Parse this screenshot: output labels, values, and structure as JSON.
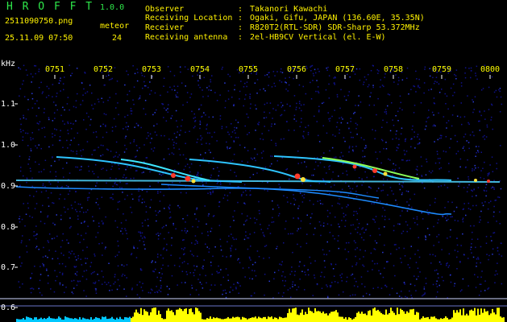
{
  "app": {
    "name": "H R O F F T",
    "version": "1.0.0"
  },
  "file": {
    "name": "2511090750.png",
    "datetime": "25.11.09 07:50"
  },
  "meteor": {
    "label": "meteor",
    "count": "24"
  },
  "info": [
    {
      "key": "Observer",
      "sep": ":",
      "value": "Takanori Kawachi"
    },
    {
      "key": "Receiving Location",
      "sep": ":",
      "value": "Ogaki, Gifu, JAPAN (136.60E, 35.35N)"
    },
    {
      "key": "Receiver",
      "sep": ":",
      "value": "R820T2(RTL-SDR) SDR-Sharp 53.372MHz"
    },
    {
      "key": "Receiving antenna",
      "sep": ":",
      "value": "2el-HB9CV Vertical (el. E-W)"
    }
  ],
  "axis": {
    "y_unit": "kHz",
    "y_ticks": [
      "1.1",
      "1.0",
      "0.9",
      "0.8",
      "0.7",
      "0.6"
    ],
    "x_ticks": [
      "0751",
      "0752",
      "0753",
      "0754",
      "0755",
      "0756",
      "0757",
      "0758",
      "0759",
      "0800"
    ]
  },
  "colors": {
    "header_green": "#2ee84a",
    "header_yellow": "#fff200",
    "tick_yellow": "#ffff00",
    "power_yellow": "#ffff00",
    "power_cyan": "#00c8ff",
    "noise_blue": "#10128a"
  }
}
